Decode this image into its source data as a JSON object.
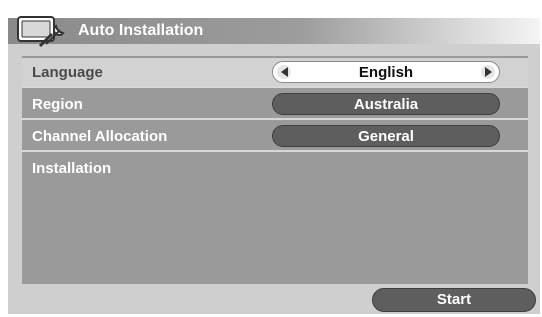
{
  "window": {
    "title": "Auto Installation",
    "icon": "wrench-tv-icon"
  },
  "settings": [
    {
      "label": "Language",
      "value": "English",
      "highlighted": true
    },
    {
      "label": "Region",
      "value": "Australia"
    },
    {
      "label": "Channel Allocation",
      "value": "General"
    },
    {
      "label": "Installation"
    }
  ],
  "actions": {
    "start_label": "Start"
  },
  "colors": {
    "frame": "#cfcfcf",
    "panel": "#9a9a9a",
    "pill_dark": "#5e5e5e",
    "highlight_row": "#d2d2d2"
  }
}
